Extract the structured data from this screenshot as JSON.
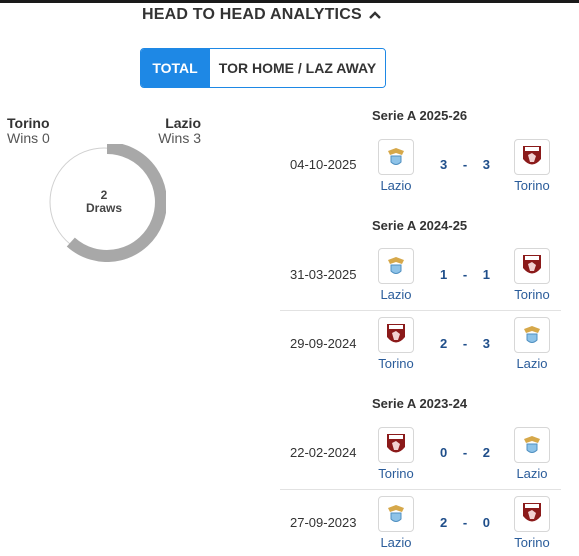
{
  "header": {
    "title": "HEAD TO HEAD ANALYTICS"
  },
  "toggle": {
    "total": "TOTAL",
    "home_away": "TOR HOME / LAZ AWAY"
  },
  "summary": {
    "left_team": "Torino",
    "left_wins": "Wins 0",
    "right_team": "Lazio",
    "right_wins": "Wins 3",
    "draws_count": "2",
    "draws_label": "Draws"
  },
  "sections": [
    {
      "title": "Serie A 2025-26",
      "matches": [
        {
          "date": "04-10-2025",
          "home": "Lazio",
          "away": "Torino",
          "home_score": "3",
          "sep": "-",
          "away_score": "3"
        }
      ]
    },
    {
      "title": "Serie A 2024-25",
      "matches": [
        {
          "date": "31-03-2025",
          "home": "Lazio",
          "away": "Torino",
          "home_score": "1",
          "sep": "-",
          "away_score": "1"
        },
        {
          "date": "29-09-2024",
          "home": "Torino",
          "away": "Lazio",
          "home_score": "2",
          "sep": "-",
          "away_score": "3"
        }
      ]
    },
    {
      "title": "Serie A 2023-24",
      "matches": [
        {
          "date": "22-02-2024",
          "home": "Torino",
          "away": "Lazio",
          "home_score": "0",
          "sep": "-",
          "away_score": "2"
        },
        {
          "date": "27-09-2023",
          "home": "Lazio",
          "away": "Torino",
          "home_score": "2",
          "sep": "-",
          "away_score": "0"
        }
      ]
    }
  ],
  "colors": {
    "accent": "#1e88e5",
    "lazio_wins": "#a8a8a8",
    "torino_wins": "#8b1a1a",
    "score": "#1f4e8a"
  },
  "icons": {
    "collapse": "chevron-up-icon",
    "lazio": "lazio-crest-icon",
    "torino": "torino-crest-icon"
  }
}
